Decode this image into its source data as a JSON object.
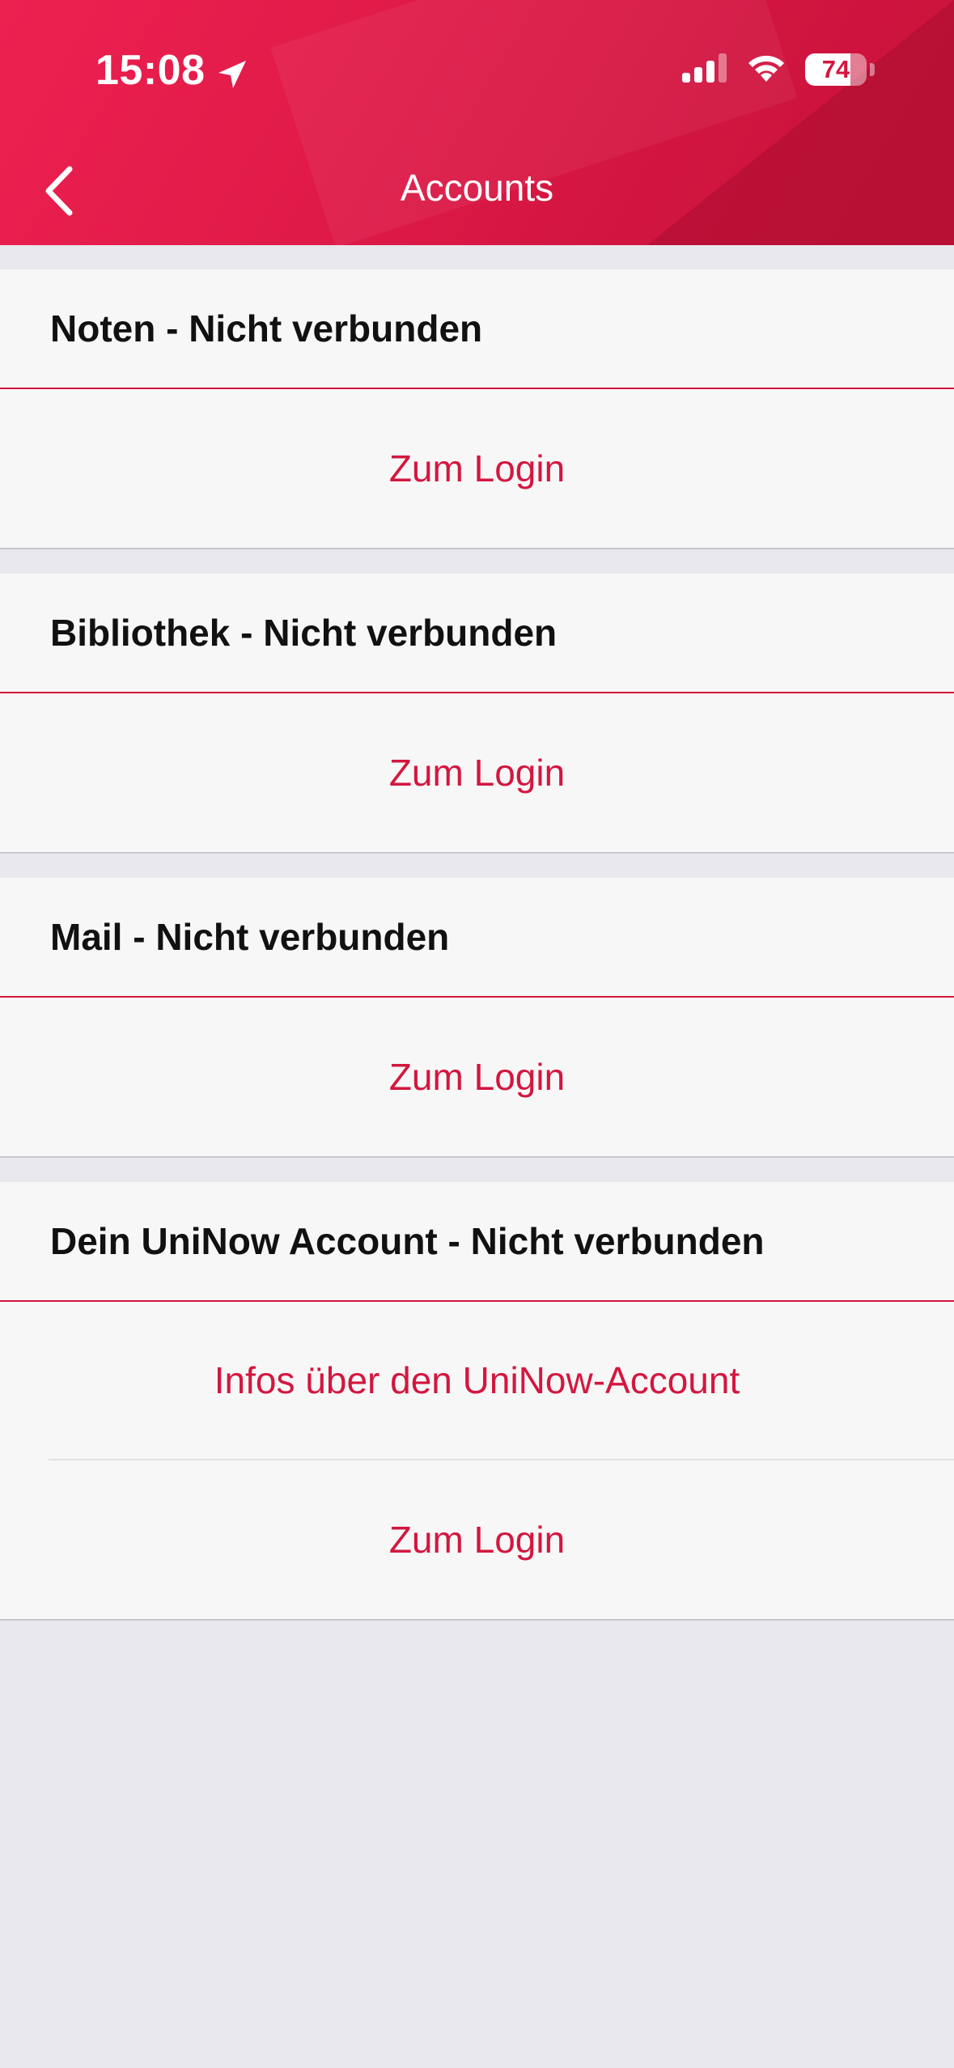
{
  "status_bar": {
    "time": "15:08",
    "battery": "74",
    "battery_level": 0.74,
    "icons": [
      "location-arrow-icon",
      "cellular-signal-icon",
      "wifi-icon",
      "battery-icon"
    ]
  },
  "nav": {
    "title": "Accounts",
    "back_icon": "chevron-left-icon"
  },
  "colors": {
    "accent": "#d3173f",
    "header_gradient_start": "#ec2150",
    "header_gradient_end": "#c8133a",
    "background": "#e8e8ed",
    "cell": "#f7f7f7"
  },
  "sections": [
    {
      "title": "Noten - Nicht verbunden",
      "actions": [
        "Zum Login"
      ]
    },
    {
      "title": "Bibliothek - Nicht verbunden",
      "actions": [
        "Zum Login"
      ]
    },
    {
      "title": "Mail - Nicht verbunden",
      "actions": [
        "Zum Login"
      ]
    },
    {
      "title": "Dein UniNow Account - Nicht verbunden",
      "actions": [
        "Infos über den UniNow-Account",
        "Zum Login"
      ]
    }
  ]
}
